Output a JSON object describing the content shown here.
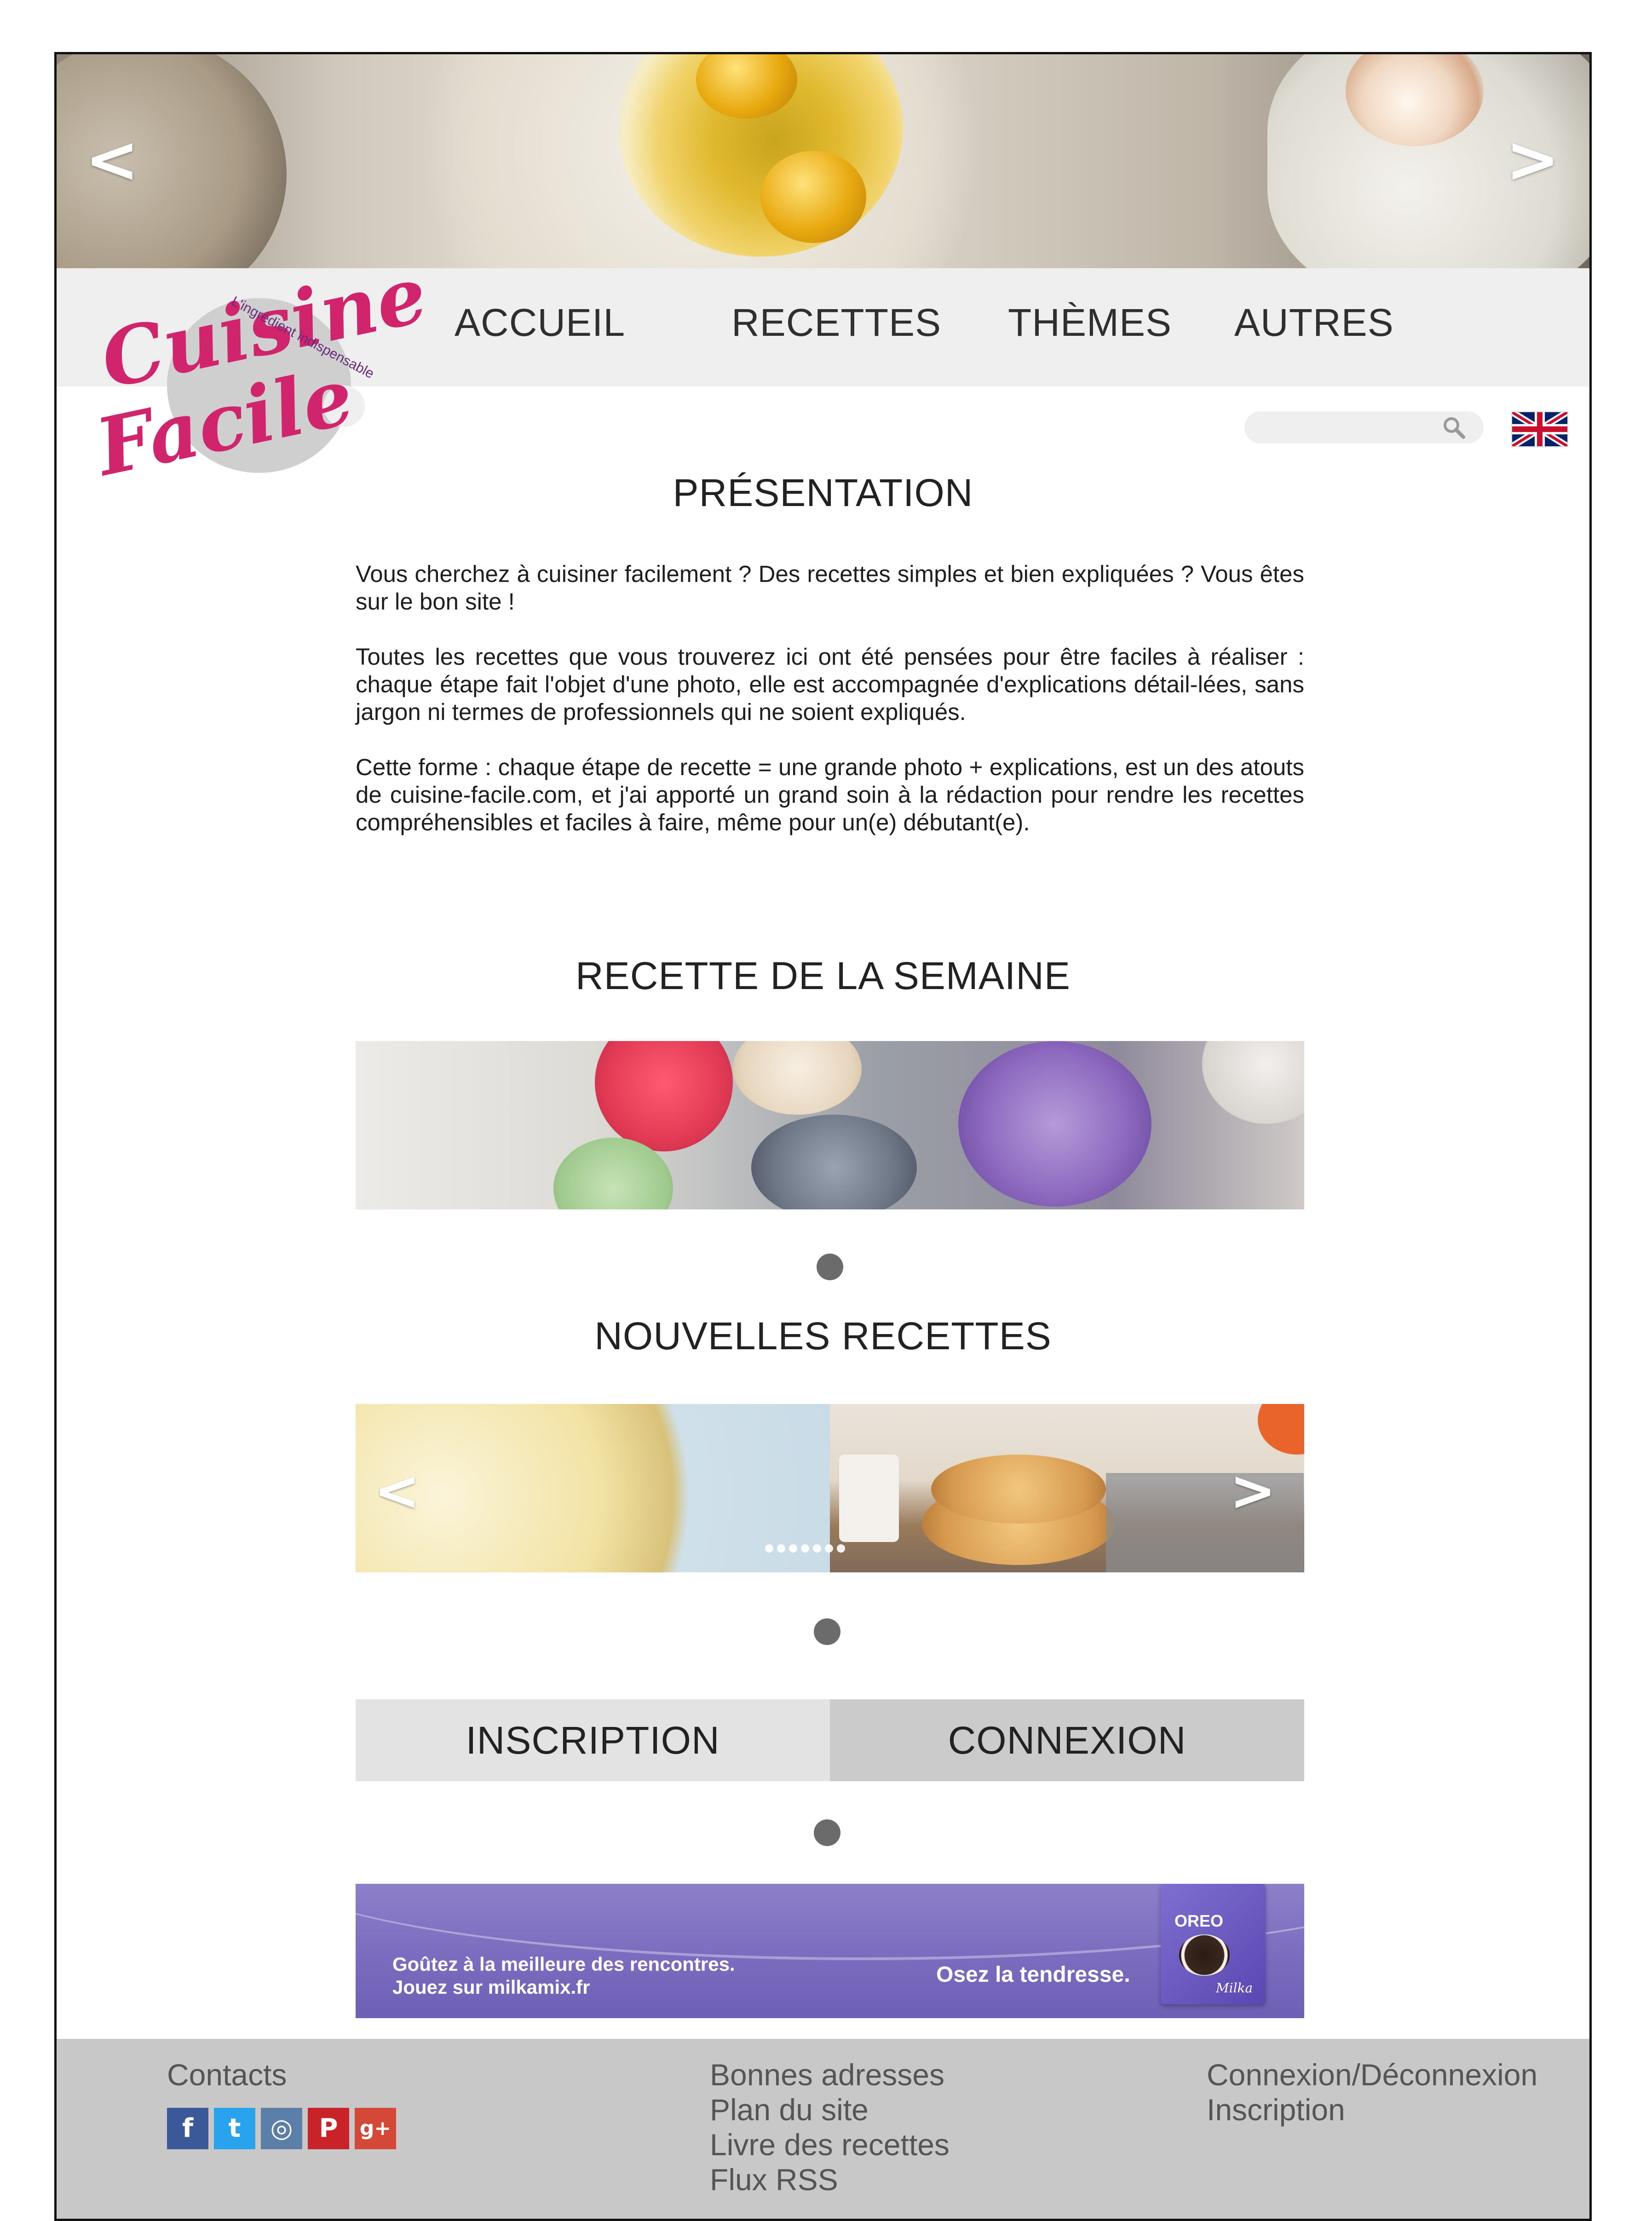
{
  "hero": {
    "prev_icon": "<",
    "next_icon": ">"
  },
  "logo": {
    "line1": "Cuisine",
    "line2": "Facile",
    "tagline": "L'ingrédient indispensable"
  },
  "nav": {
    "items": [
      "ACCUEIL",
      "RECETTES",
      "THÈMES",
      "AUTRES"
    ]
  },
  "search": {
    "placeholder": "",
    "value": ""
  },
  "language_flag": "uk-flag-icon",
  "presentation": {
    "title": "PRÉSENTATION",
    "paragraphs": [
      "Vous cherchez à cuisiner facilement ? Des recettes simples et bien expliquées ? Vous êtes sur le bon site !",
      "Toutes les recettes que vous trouverez ici ont été pensées pour être faciles à réaliser : chaque étape fait l'objet d'une photo, elle est accompagnée d'explications détail-lées, sans jargon ni termes de professionnels qui ne soient expliqués.",
      "Cette forme : chaque étape de recette = une grande photo + explications, est un des atouts de cuisine-facile.com, et j'ai apporté un grand soin à la rédaction pour rendre les recettes compréhensibles et faciles à faire, même pour un(e) débutant(e)."
    ]
  },
  "week": {
    "title": "RECETTE DE LA SEMAINE"
  },
  "new_recipes": {
    "title": "NOUVELLES RECETTES",
    "prev_icon": "<",
    "next_icon": ">",
    "pager_count": 7
  },
  "auth": {
    "inscription": "INSCRIPTION",
    "connexion": "CONNEXION"
  },
  "ad": {
    "line1": "Goûtez à la meilleure des rencontres.",
    "line2": "Jouez sur milkamix.fr",
    "slogan": "Osez la tendresse.",
    "pack_brand": "OREO",
    "pack_maker": "Milka"
  },
  "footer": {
    "contacts": "Contacts",
    "social": [
      {
        "glyph": "f",
        "color": "#3b5998"
      },
      {
        "glyph": "t",
        "color": "#2aa3ef"
      },
      {
        "glyph": "◎",
        "color": "#5b7fa8"
      },
      {
        "glyph": "P",
        "color": "#c92228"
      },
      {
        "glyph": "g+",
        "color": "#d34836"
      }
    ],
    "middle": [
      "Bonnes adresses",
      "Plan du site",
      "Livre des recettes",
      "Flux RSS"
    ],
    "right": [
      "Connexion/Déconnexion",
      "Inscription"
    ]
  },
  "colors": {
    "brand_pink": "#d0246d",
    "nav_bg": "#efefef",
    "footer_bg": "#c8c8c8",
    "btn_light": "#e3e3e3",
    "btn_dark": "#cbcbcb"
  }
}
